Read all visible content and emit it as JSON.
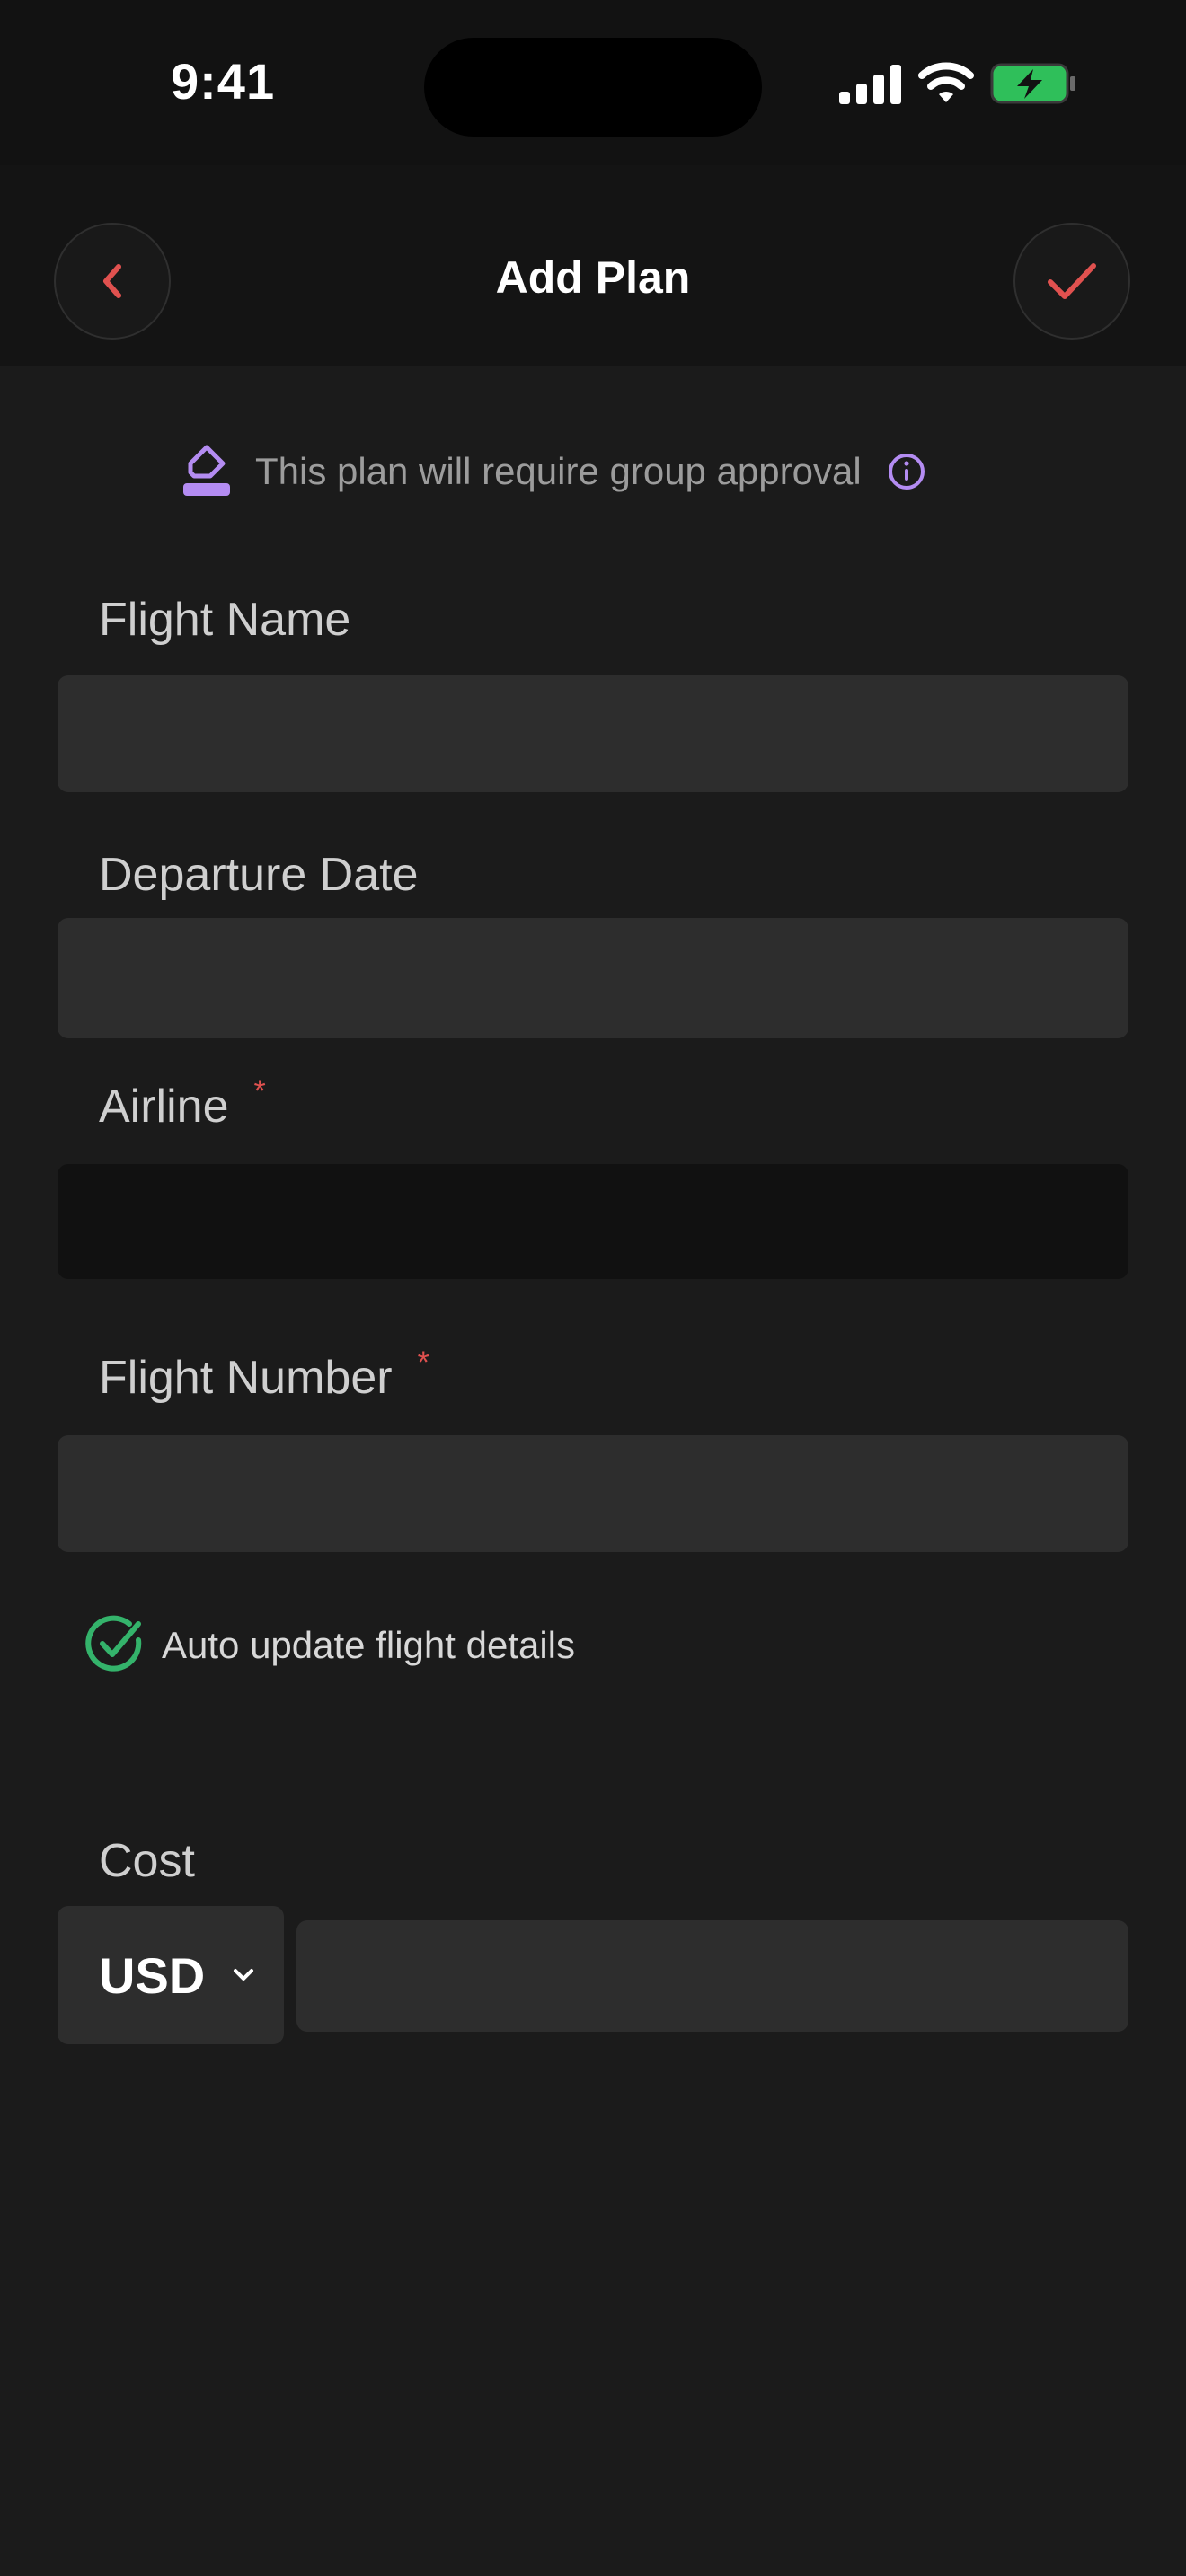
{
  "status_bar": {
    "time": "9:41",
    "icons": [
      "signal-icon",
      "wifi-icon",
      "battery-charging-icon"
    ],
    "battery_color": "#2fbf5a"
  },
  "header": {
    "title": "Add Plan",
    "back_icon": "chevron-left-icon",
    "confirm_icon": "checkmark-icon",
    "accent_color": "#e0514f"
  },
  "approval_notice": {
    "text": "This plan will require group approval",
    "icon": "eraser-icon",
    "info_icon": "info-icon",
    "accent_color": "#b48cf2"
  },
  "form": {
    "flight_name": {
      "label": "Flight Name",
      "value": "",
      "placeholder": ""
    },
    "departure_date": {
      "label": "Departure Date",
      "value": "",
      "placeholder": ""
    },
    "airline": {
      "label": "Airline",
      "required_mark": "*",
      "value": "",
      "placeholder": ""
    },
    "flight_number": {
      "label": "Flight Number",
      "required_mark": "*",
      "value": "",
      "placeholder": ""
    },
    "auto_update": {
      "label": "Auto update flight details",
      "checked": true,
      "color": "#34b36b"
    },
    "cost": {
      "label": "Cost",
      "currency": "USD",
      "value": "",
      "placeholder": ""
    }
  }
}
